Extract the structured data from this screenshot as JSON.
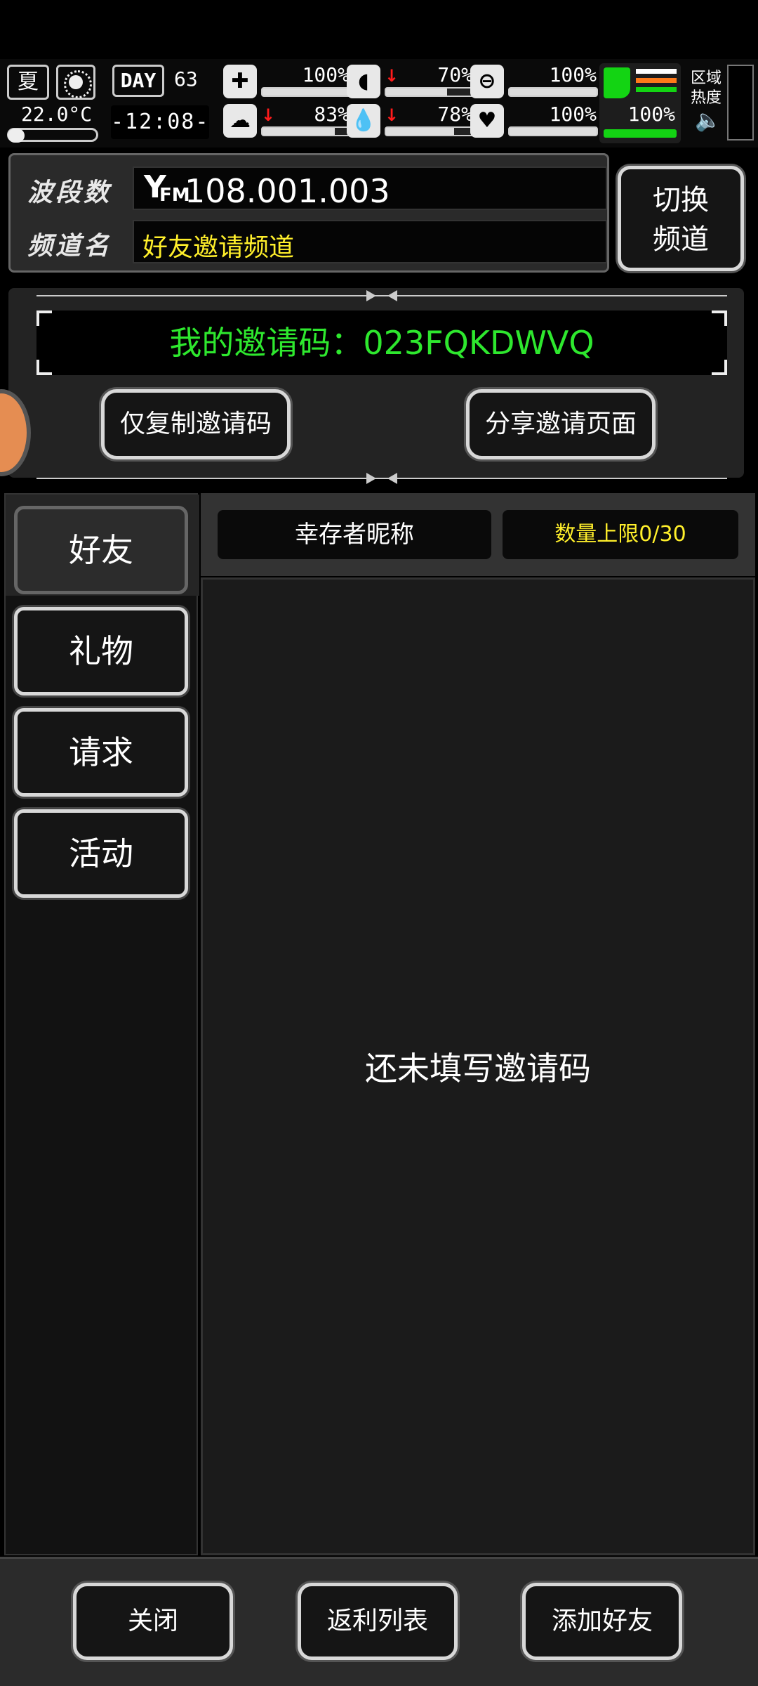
{
  "hud": {
    "season": "夏",
    "temperature": "22.0°C",
    "day_label": "DAY",
    "day_number": "63",
    "clock": "-12:08-",
    "stats": [
      {
        "icon": "medkit-icon",
        "glyph": "✚",
        "value": "100%",
        "level": 1.0,
        "down": false
      },
      {
        "icon": "stomach-icon",
        "glyph": "◖",
        "value": "70%",
        "level": 0.7,
        "down": true
      },
      {
        "icon": "pill-icon",
        "glyph": "⊖",
        "value": "100%",
        "level": 1.0,
        "down": false
      },
      {
        "icon": "brain-icon",
        "glyph": "☁",
        "value": "83%",
        "level": 0.83,
        "down": true
      },
      {
        "icon": "water-drop-icon",
        "glyph": "💧",
        "value": "78%",
        "level": 0.78,
        "down": true
      },
      {
        "icon": "heart-icon",
        "glyph": "♥",
        "value": "100%",
        "level": 1.0,
        "down": false
      }
    ],
    "legs_value": "100%",
    "area_label_line1": "区域",
    "area_label_line2": "热度",
    "colors": {
      "green": "#13d413",
      "orange": "#ff7a1a",
      "red": "#ff1b1b"
    }
  },
  "frequency": {
    "band_label": "波段数",
    "band_value": "108.001.003",
    "fm_label": "FM",
    "channel_label": "频道名",
    "channel_value": "好友邀请频道",
    "switch_line1": "切换",
    "switch_line2": "频道"
  },
  "invite": {
    "code_text": "我的邀请码：023FQKDWVQ",
    "copy_button": "仅复制邀请码",
    "share_button": "分享邀请页面"
  },
  "tabs": [
    {
      "label": "好友",
      "active": true
    },
    {
      "label": "礼物",
      "active": false
    },
    {
      "label": "请求",
      "active": false
    },
    {
      "label": "活动",
      "active": false
    }
  ],
  "content": {
    "col_nickname": "幸存者昵称",
    "col_limit": "数量上限0/30",
    "empty_message": "还未填写邀请码"
  },
  "bottom": {
    "close": "关闭",
    "rebate_list": "返利列表",
    "add_friend": "添加好友"
  }
}
